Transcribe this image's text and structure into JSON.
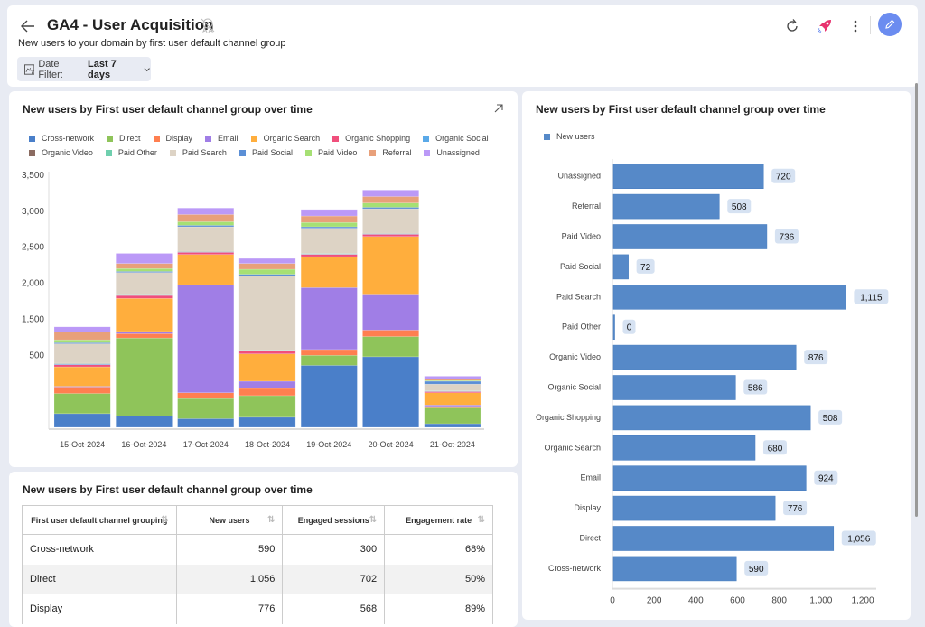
{
  "header": {
    "title": "GA4 - User Acquisition",
    "subtitle": "New users to your domain by first user default channel group",
    "date_filter_label": "Date Filter:",
    "date_filter_value": "Last 7 days",
    "icons": [
      "back-arrow-icon",
      "certified-badge-icon",
      "refresh-icon",
      "rocket-icon",
      "more-vert-icon",
      "edit-pencil-icon"
    ],
    "colors": {
      "edit_button": "#6b8cf0",
      "rocket": "#e8336f"
    }
  },
  "stacked_card": {
    "title": "New users by First user default channel group over time"
  },
  "bar_card": {
    "title": "New users by First user default channel group over time"
  },
  "table_card": {
    "title": "New users by First user default channel group over time",
    "columns": [
      "First user default channel grouping",
      "New users",
      "Engaged sessions",
      "Engagement rate"
    ],
    "rows": [
      [
        "Cross-network",
        "590",
        "300",
        "68%"
      ],
      [
        "Direct",
        "1,056",
        "702",
        "50%"
      ],
      [
        "Display",
        "776",
        "568",
        "89%"
      ]
    ]
  },
  "chart_data": [
    {
      "type": "bar",
      "stacked": true,
      "title": "New users by First user default channel group over time",
      "categories": [
        "15-Oct-2024",
        "16-Oct-2024",
        "17-Oct-2024",
        "18-Oct-2024",
        "19-Oct-2024",
        "20-Oct-2024",
        "21-Oct-2024"
      ],
      "yticks": [
        "500",
        "1,500",
        "2,000",
        "2,500",
        "3,000",
        "3,500"
      ],
      "ylim": [
        0,
        3500
      ],
      "legend_position": "top-left",
      "series": [
        {
          "name": "Cross-network",
          "color": "#4a7fc9",
          "values": [
            190,
            160,
            120,
            140,
            860,
            980,
            50
          ]
        },
        {
          "name": "Direct",
          "color": "#8fc45a",
          "values": [
            280,
            1080,
            280,
            300,
            140,
            280,
            220
          ]
        },
        {
          "name": "Display",
          "color": "#ff7f50",
          "values": [
            90,
            60,
            80,
            100,
            80,
            90,
            20
          ]
        },
        {
          "name": "Email",
          "color": "#a07ee6",
          "values": [
            10,
            30,
            1500,
            100,
            860,
            500,
            20
          ]
        },
        {
          "name": "Organic Search",
          "color": "#ffae3d",
          "values": [
            270,
            460,
            420,
            380,
            430,
            800,
            170
          ]
        },
        {
          "name": "Organic Shopping",
          "color": "#f04f7c",
          "values": [
            30,
            40,
            30,
            40,
            30,
            30,
            15
          ]
        },
        {
          "name": "Organic Social",
          "color": "#5aa9e8",
          "values": [
            10,
            10,
            5,
            5,
            5,
            5,
            5
          ]
        },
        {
          "name": "Organic Video",
          "color": "#8b6b61",
          "values": [
            5,
            5,
            5,
            5,
            5,
            5,
            5
          ]
        },
        {
          "name": "Paid Other",
          "color": "#6fcfae",
          "values": [
            5,
            5,
            5,
            5,
            5,
            5,
            5
          ]
        },
        {
          "name": "Paid Search",
          "color": "#ddd3c5",
          "values": [
            270,
            300,
            340,
            1030,
            350,
            340,
            90
          ]
        },
        {
          "name": "Paid Social",
          "color": "#5b8fd6",
          "values": [
            15,
            15,
            20,
            20,
            20,
            20,
            40
          ]
        },
        {
          "name": "Paid Video",
          "color": "#a6e074",
          "values": [
            40,
            40,
            50,
            70,
            60,
            60,
            10
          ]
        },
        {
          "name": "Referral",
          "color": "#e8a07a",
          "values": [
            110,
            70,
            100,
            80,
            90,
            90,
            20
          ]
        },
        {
          "name": "Unassigned",
          "color": "#bb99f7",
          "values": [
            70,
            140,
            90,
            70,
            90,
            90,
            40
          ]
        }
      ]
    },
    {
      "type": "bar",
      "orientation": "horizontal",
      "title": "New users by First user default channel group over time",
      "legend": [
        "New users"
      ],
      "legend_position": "top-left",
      "color": "#5689c8",
      "categories": [
        "Unassigned",
        "Referral",
        "Paid Video",
        "Paid Social",
        "Paid Search",
        "Paid Other",
        "Organic Video",
        "Organic Social",
        "Organic Shopping",
        "Organic Search",
        "Email",
        "Display",
        "Direct",
        "Cross-network"
      ],
      "values": [
        720,
        508,
        736,
        72,
        1115,
        0,
        876,
        586,
        945,
        680,
        924,
        776,
        1056,
        590
      ],
      "data_labels": [
        "720",
        "508",
        "736",
        "72",
        "1,115",
        "0",
        "876",
        "586",
        "508",
        "680",
        "924",
        "776",
        "1,056",
        "590"
      ],
      "xticks": [
        "0",
        "200",
        "400",
        "600",
        "800",
        "1,000",
        "1,200"
      ],
      "xlim": [
        0,
        1300
      ]
    }
  ]
}
